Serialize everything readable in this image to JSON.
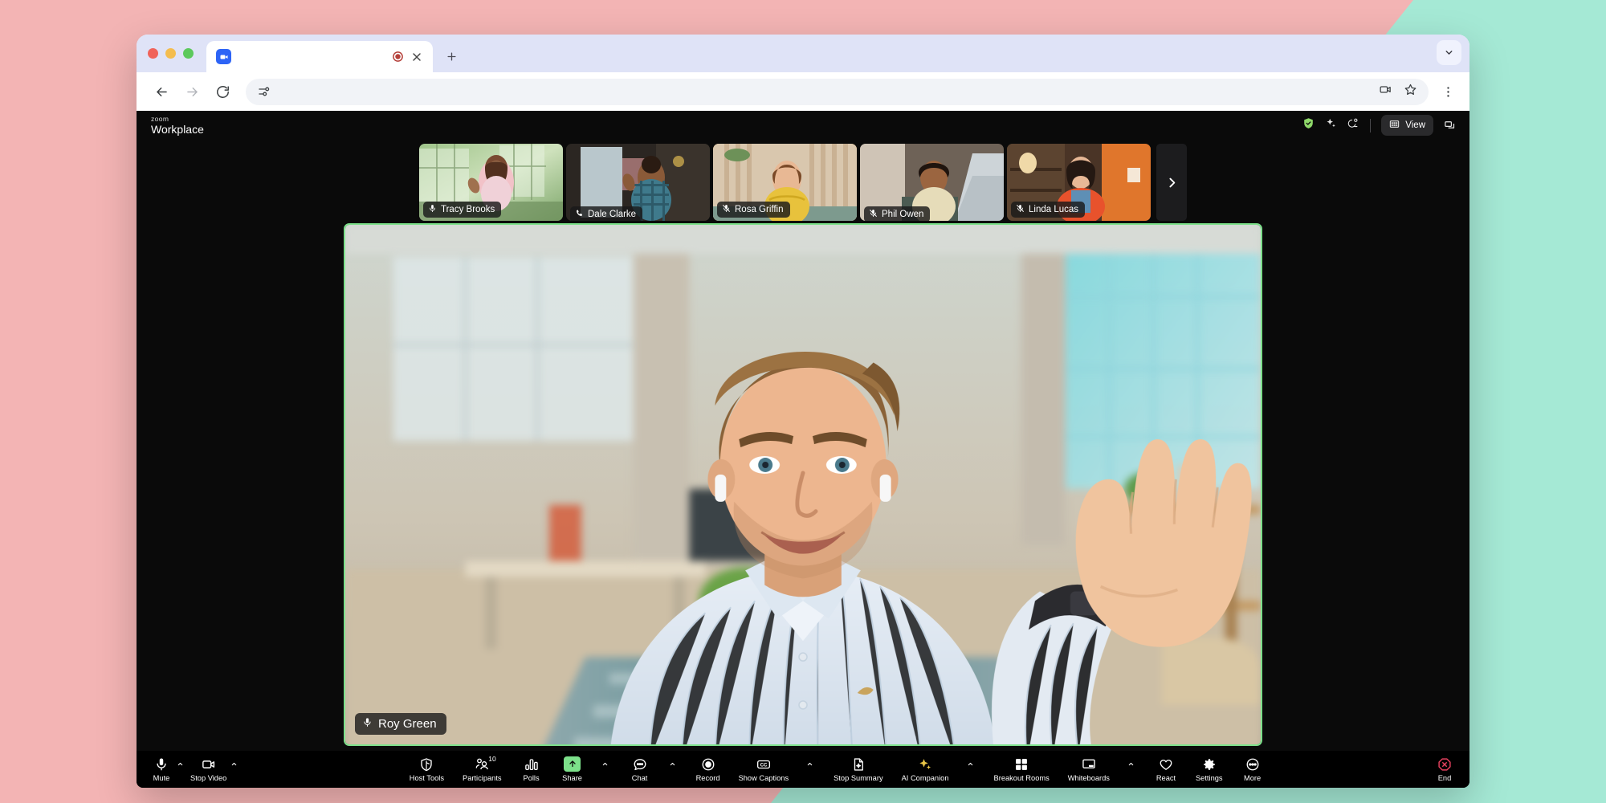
{
  "browser": {
    "tab": {
      "title": "",
      "favicon_icon": "zoom-favicon",
      "recording_icon": "recording-indicator",
      "close_icon": "close-icon"
    },
    "newtab_label": "+",
    "tabstrip_chevron_icon": "chevron-down-icon",
    "nav": {
      "back_icon": "back-arrow-icon",
      "forward_icon": "forward-arrow-icon",
      "reload_icon": "reload-icon",
      "omnibox_left_icon": "page-settings-icon",
      "url": "",
      "camera_icon": "camera-permission-icon",
      "bookmark_icon": "star-icon",
      "menu_icon": "kebab-menu-icon"
    }
  },
  "zoom": {
    "logo": {
      "line1": "zoom",
      "line2": "Workplace"
    },
    "header": {
      "encryption_icon": "shield-check-icon",
      "ai_icon": "sparkle-icon",
      "connection_icon": "network-status-icon",
      "view_label": "View",
      "view_icon": "grid-view-icon",
      "pip_icon": "minimize-window-icon"
    },
    "participants": [
      {
        "name": "Tracy Brooks",
        "status_icon": "mic-on-icon",
        "active": false
      },
      {
        "name": "Dale Clarke",
        "status_icon": "phone-icon",
        "active": false
      },
      {
        "name": "Rosa Griffin",
        "status_icon": "mic-off-icon",
        "active": true
      },
      {
        "name": "Phil Owen",
        "status_icon": "mic-off-icon",
        "active": false
      },
      {
        "name": "Linda Lucas",
        "status_icon": "mic-off-icon",
        "active": false
      }
    ],
    "strip_next_icon": "chevron-right-icon",
    "speaker": {
      "name": "Roy Green",
      "status_icon": "mic-on-icon"
    },
    "toolbar": {
      "mute": {
        "label": "Mute",
        "icon": "microphone-icon",
        "caret": true
      },
      "stop_video": {
        "label": "Stop Video",
        "icon": "video-camera-icon",
        "caret": true
      },
      "host_tools": {
        "label": "Host Tools",
        "icon": "shield-icon"
      },
      "participants": {
        "label": "Participants",
        "icon": "participants-icon",
        "count": "10"
      },
      "polls": {
        "label": "Polls",
        "icon": "polls-bar-icon"
      },
      "share": {
        "label": "Share",
        "icon": "share-screen-icon",
        "caret": true,
        "accent": "#7ce08a"
      },
      "chat": {
        "label": "Chat",
        "icon": "chat-bubble-icon",
        "caret": true
      },
      "record": {
        "label": "Record",
        "icon": "record-icon"
      },
      "show_captions": {
        "label": "Show Captions",
        "icon": "closed-caption-icon",
        "caret": true
      },
      "stop_summary": {
        "label": "Stop Summary",
        "icon": "summary-doc-icon"
      },
      "ai_companion": {
        "label": "AI Companion",
        "icon": "sparkle-icon",
        "caret": true,
        "accent": "#e8c547"
      },
      "breakout_rooms": {
        "label": "Breakout Rooms",
        "icon": "grid-squares-icon"
      },
      "whiteboards": {
        "label": "Whiteboards",
        "icon": "whiteboard-icon",
        "caret": true
      },
      "react": {
        "label": "React",
        "icon": "heart-icon"
      },
      "settings": {
        "label": "Settings",
        "icon": "gear-icon"
      },
      "more": {
        "label": "More",
        "icon": "ellipsis-circle-icon"
      },
      "end": {
        "label": "End",
        "icon": "end-call-octagon-icon",
        "accent": "#e8425f"
      }
    }
  },
  "theme": {
    "bg_pink": "#f3b4b4",
    "bg_mint": "#a5e9d5",
    "active_speaker_border": "#7ce08a",
    "thumb_active_border": "#e8a13a",
    "app_bg": "#0a0a0a"
  }
}
